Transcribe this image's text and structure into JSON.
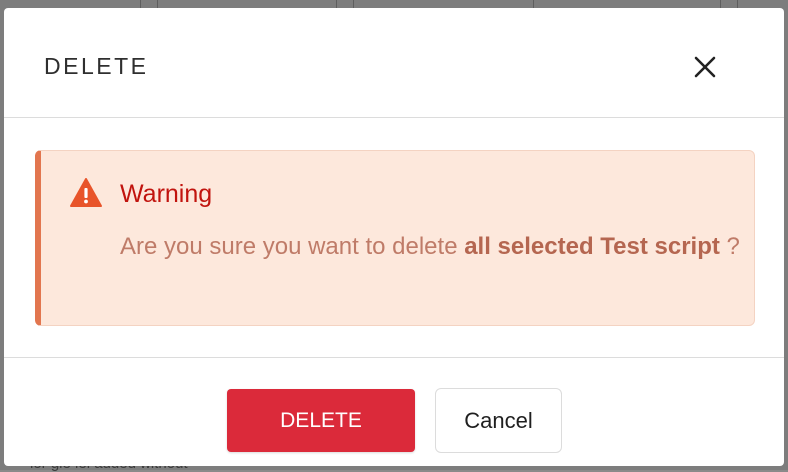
{
  "background": {
    "partial_text": "ior gle    iel added without"
  },
  "modal": {
    "title": "DELETE",
    "close_icon": "close-icon"
  },
  "alert": {
    "icon": "warning-triangle-icon",
    "title": "Warning",
    "message_prefix": "Are you sure you want to delete ",
    "message_bold": "all selected Test script",
    "message_suffix": " ?"
  },
  "footer": {
    "delete_label": "DELETE",
    "cancel_label": "Cancel"
  },
  "colors": {
    "delete_button": "#db2a3a",
    "alert_background": "#fde8dc",
    "alert_border": "#e2764f",
    "warning_title": "#c1140e",
    "warning_icon": "#e8542a"
  }
}
